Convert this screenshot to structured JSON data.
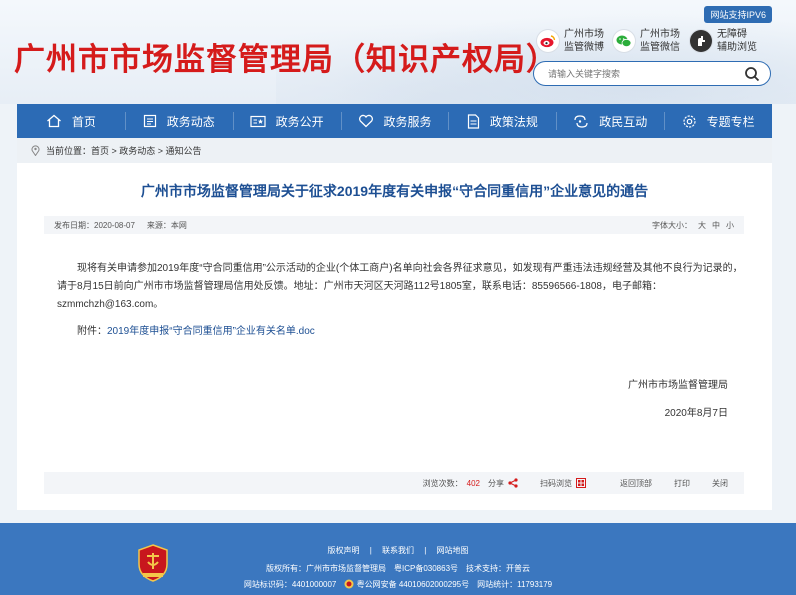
{
  "header": {
    "site_title": "广州市市场监督管理局（知识产权局）",
    "ipv6_badge": "网站支持IPV6",
    "social": [
      {
        "line1": "广州市场",
        "line2": "监管微博",
        "icon": "weibo-icon"
      },
      {
        "line1": "广州市场",
        "line2": "监管微信",
        "icon": "wechat-icon"
      },
      {
        "line1": "无障碍",
        "line2": "辅助浏览",
        "icon": "accessibility-icon"
      }
    ],
    "search_placeholder": "请输入关键字搜索"
  },
  "nav": {
    "items": [
      {
        "label": "首页",
        "icon": "home-icon"
      },
      {
        "label": "政务动态",
        "icon": "news-icon"
      },
      {
        "label": "政务公开",
        "icon": "open-affairs-icon"
      },
      {
        "label": "政务服务",
        "icon": "heart-icon"
      },
      {
        "label": "政策法规",
        "icon": "document-icon"
      },
      {
        "label": "政民互动",
        "icon": "interaction-icon"
      },
      {
        "label": "专题专栏",
        "icon": "gear-icon"
      }
    ]
  },
  "breadcrumb": {
    "prefix": "当前位置：",
    "path": "首页 > 政务动态 > 通知公告"
  },
  "article": {
    "title": "广州市市场监督管理局关于征求2019年度有关申报“守合同重信用”企业意见的通告",
    "meta": {
      "date_label": "发布日期：",
      "date": "2020-08-07",
      "source_label": "来源：",
      "source": "本网",
      "font_size_label": "字体大小：",
      "font_large": "大",
      "font_medium": "中",
      "font_small": "小"
    },
    "body": "现将有关申请参加2019年度“守合同重信用”公示活动的企业(个体工商户)名单向社会各界征求意见，如发现有严重违法违规经营及其他不良行为记录的，请于8月15日前向广州市市场监督管理局信用处反馈。地址：广州市天河区天河路112号1805室，联系电话：85596566-1808，电子邮箱：szmmchzh@163.com。",
    "attachment_label": "附件：",
    "attachment_link": "2019年度申报“守合同重信用”企业有关名单.doc",
    "sign_org": "广州市市场监督管理局",
    "sign_date": "2020年8月7日"
  },
  "actions": {
    "views_label": "浏览次数：",
    "views_count": "402",
    "share": "分享",
    "scan": "扫码浏览",
    "top": "返回顶部",
    "print": "打印",
    "close": "关闭"
  },
  "footer": {
    "links": [
      "版权声明",
      "联系我们",
      "网站地图"
    ],
    "divider": "|",
    "copyright": "版权所有：广州市市场监督管理局",
    "icp": "粤ICP备030863号",
    "tech": "技术支持：开普云",
    "site_code": "网站标识码：4401000007",
    "police": "粤公网安备 44010602000295号",
    "stats": "网站统计：11793179"
  },
  "colors": {
    "brand_red": "#d51b1b",
    "nav_blue": "#2c6bb5",
    "title_blue": "#1d4f93",
    "footer_blue": "#3b77bf"
  }
}
